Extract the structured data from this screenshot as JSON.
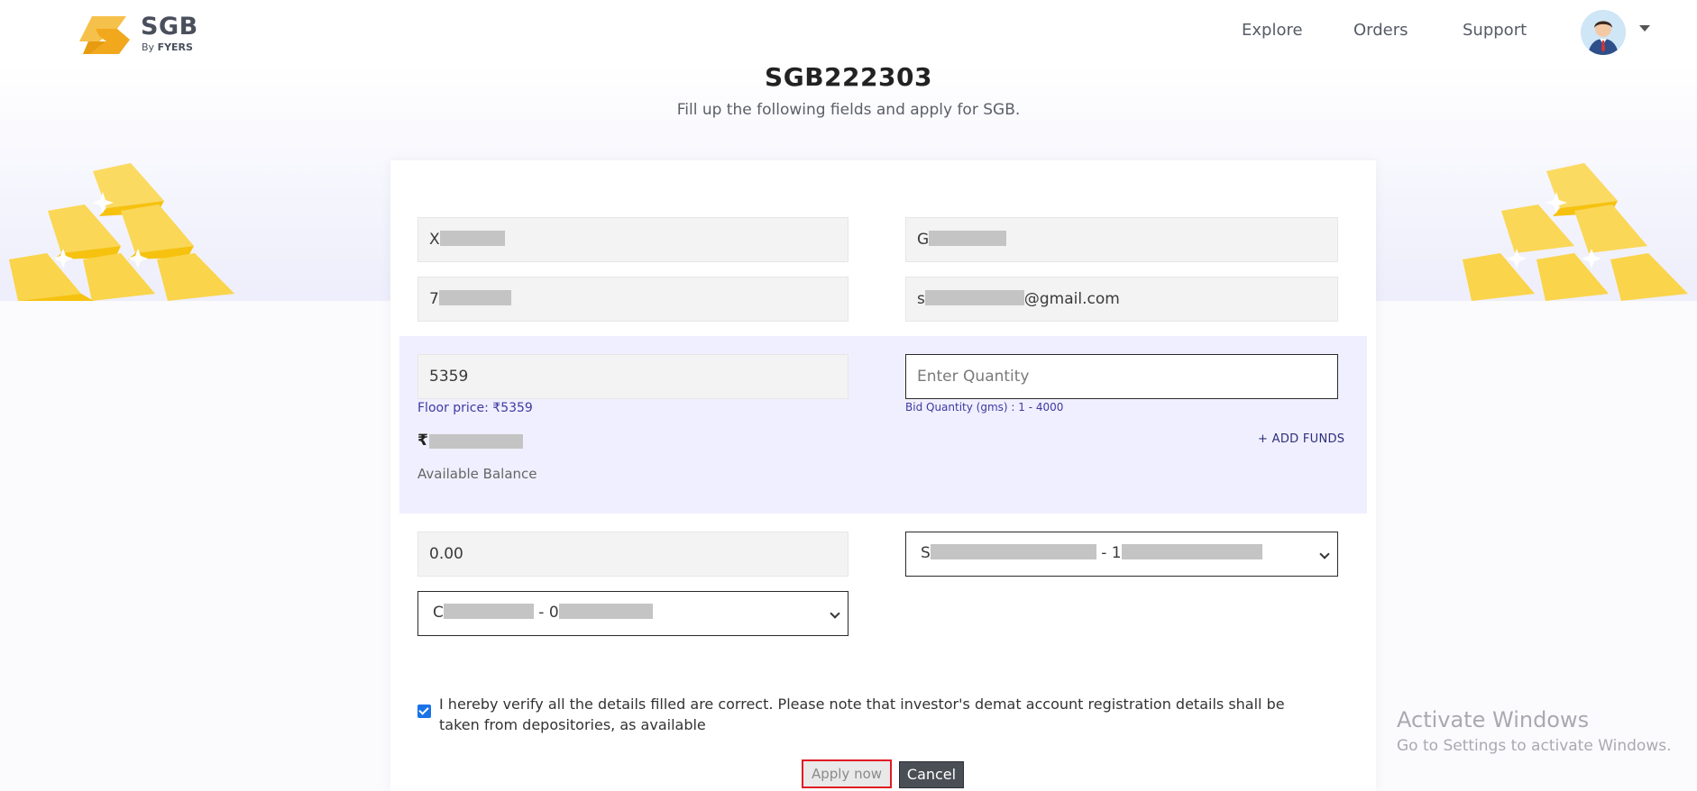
{
  "header": {
    "brand": "SGB",
    "brand_by": "By",
    "brand_company": "FYERS",
    "nav": {
      "explore": "Explore",
      "orders": "Orders",
      "support": "Support"
    },
    "avatar_icon": "user-avatar-icon"
  },
  "page": {
    "title": "SGB222303",
    "subtitle": "Fill up the following fields and apply for SGB."
  },
  "form": {
    "first_name_visible": "X",
    "last_name_visible": "G",
    "phone_visible": "7",
    "email_prefix": "s",
    "email_suffix": "@gmail.com",
    "price_value": "5359",
    "floor_price_hint": "Floor price: ₹5359",
    "quantity_placeholder": "Enter Quantity",
    "bid_quantity_hint": "Bid Quantity (gms) : 1 - 4000",
    "currency_symbol": "₹",
    "available_balance_label": "Available Balance",
    "add_funds_label": "+ ADD FUNDS",
    "total_amount": "0.00",
    "bank_select": {
      "prefix": "S",
      "separator": "- 1"
    },
    "demat_select": {
      "prefix": "C",
      "separator": "- 0"
    },
    "consent_checked": true,
    "consent_text": "I hereby verify all the details filled are correct. Please note that investor's demat account registration details shall be taken from depositories, as available",
    "apply_label": "Apply now",
    "cancel_label": "Cancel"
  },
  "windows_watermark": {
    "title": "Activate Windows",
    "subtitle": "Go to Settings to activate Windows."
  },
  "colors": {
    "accent_gold": "#f7c616",
    "hint_blue": "#3d3aa0",
    "band_lavender": "#f0efff",
    "apply_border_red": "#e01b24"
  }
}
